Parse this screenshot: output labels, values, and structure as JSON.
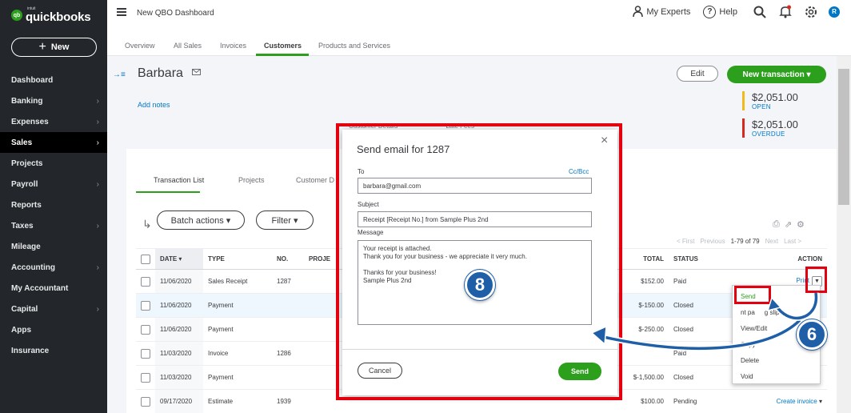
{
  "app": {
    "logo_small": "intuit",
    "logo": "quickbooks",
    "logo_mark": "qb"
  },
  "sidebar": {
    "new_label": "New",
    "items": [
      {
        "label": "Dashboard",
        "chevron": false,
        "active": false
      },
      {
        "label": "Banking",
        "chevron": true,
        "active": false
      },
      {
        "label": "Expenses",
        "chevron": true,
        "active": false
      },
      {
        "label": "Sales",
        "chevron": true,
        "active": true
      },
      {
        "label": "Projects",
        "chevron": false,
        "active": false
      },
      {
        "label": "Payroll",
        "chevron": true,
        "active": false
      },
      {
        "label": "Reports",
        "chevron": false,
        "active": false
      },
      {
        "label": "Taxes",
        "chevron": true,
        "active": false
      },
      {
        "label": "Mileage",
        "chevron": false,
        "active": false
      },
      {
        "label": "Accounting",
        "chevron": true,
        "active": false
      },
      {
        "label": "My Accountant",
        "chevron": false,
        "active": false
      },
      {
        "label": "Capital",
        "chevron": true,
        "active": false
      },
      {
        "label": "Apps",
        "chevron": false,
        "active": false
      },
      {
        "label": "Insurance",
        "chevron": false,
        "active": false
      }
    ]
  },
  "topbar": {
    "company": "New QBO Dashboard",
    "my_experts": "My Experts",
    "help": "Help",
    "avatar_initial": "R"
  },
  "main_tabs": [
    "Overview",
    "All Sales",
    "Invoices",
    "Customers",
    "Products and Services"
  ],
  "customer": {
    "name": "Barbara",
    "add_notes": "Add notes",
    "edit": "Edit",
    "new_transaction": "New transaction",
    "open_amount": "$2,051.00",
    "open_label": "OPEN",
    "overdue_amount": "$2,051.00",
    "overdue_label": "OVERDUE"
  },
  "sub_tabs": [
    "Transaction List",
    "Projects",
    "Customer D"
  ],
  "behind_modal_tabs": [
    "Customer Details",
    "Late Fees"
  ],
  "toolbar": {
    "batch_actions": "Batch actions",
    "filter": "Filter"
  },
  "pager": {
    "first": "< First",
    "previous": "Previous",
    "range": "1-79 of 79",
    "next": "Next",
    "last": "Last >"
  },
  "table": {
    "headers": {
      "date": "DATE",
      "type": "TYPE",
      "no": "NO.",
      "project": "PROJE",
      "total": "TOTAL",
      "status": "STATUS",
      "action": "ACTION"
    },
    "rows": [
      {
        "date": "11/06/2020",
        "type": "Sales Receipt",
        "no": "1287",
        "total": "$152.00",
        "status": "Paid",
        "action": "Print"
      },
      {
        "date": "11/06/2020",
        "type": "Payment",
        "no": "",
        "total": "$-150.00",
        "status": "Closed",
        "action": ""
      },
      {
        "date": "11/06/2020",
        "type": "Payment",
        "no": "",
        "total": "$-250.00",
        "status": "Closed",
        "action": ""
      },
      {
        "date": "11/03/2020",
        "type": "Invoice",
        "no": "1286",
        "total": "",
        "status": "Paid",
        "action": ""
      },
      {
        "date": "11/03/2020",
        "type": "Payment",
        "no": "",
        "total": "$-1,500.00",
        "status": "Closed",
        "action": ""
      },
      {
        "date": "09/17/2020",
        "type": "Estimate",
        "no": "1939",
        "total": "$100.00",
        "status": "Pending",
        "action": "Create invoice"
      }
    ]
  },
  "action_menu": {
    "items": [
      "Send",
      "Print packing slip",
      "View/Edit",
      "Copy",
      "Delete",
      "Void"
    ],
    "visible_labels": [
      "Send",
      "nt pa",
      "g slip",
      "View/Edit",
      "Copy",
      "Delete",
      "Void"
    ]
  },
  "modal": {
    "title": "Send email for 1287",
    "to_label": "To",
    "cc_bcc": "Cc/Bcc",
    "to_value": "barbara@gmail.com",
    "subject_label": "Subject",
    "subject_value": "Receipt [Receipt No.] from Sample Plus 2nd",
    "message_label": "Message",
    "message_value": "Your receipt is attached.\nThank you for your business - we appreciate it very much.\n\nThanks for your business!\nSample Plus 2nd",
    "cancel": "Cancel",
    "send": "Send"
  },
  "callouts": {
    "step_8": "8",
    "step_6": "6"
  },
  "colors": {
    "brand_green": "#2ca01c",
    "link_blue": "#0077c5",
    "sidebar_bg": "#23272b",
    "highlight_red": "#e3000f",
    "callout_blue": "#1f5fa8"
  }
}
